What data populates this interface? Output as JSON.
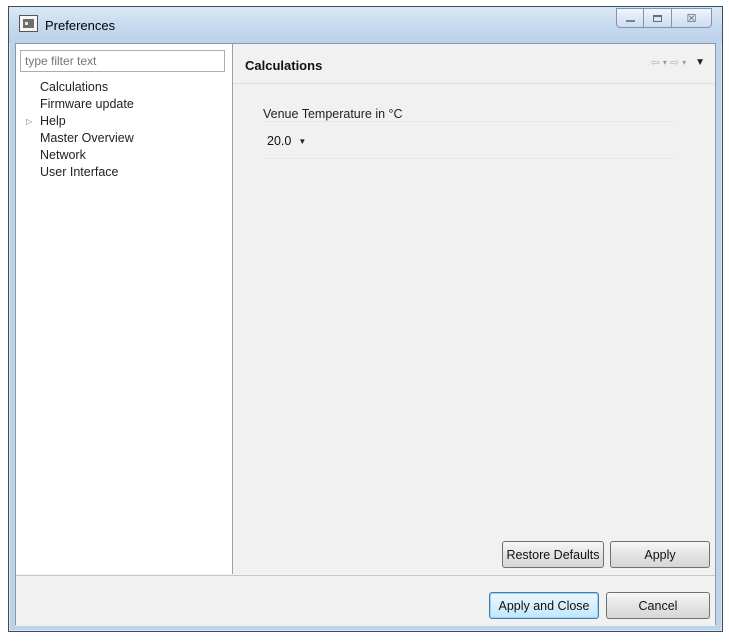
{
  "window": {
    "title": "Preferences",
    "app_icon": "preferences-app-icon",
    "controls": [
      "minimize-icon",
      "maximize-icon",
      "close-icon"
    ],
    "close_glyph": "☒"
  },
  "sidebar": {
    "filter_placeholder": "type filter text",
    "items": [
      {
        "label": "Calculations",
        "expandable": false
      },
      {
        "label": "Firmware update",
        "expandable": false
      },
      {
        "label": "Help",
        "expandable": true
      },
      {
        "label": "Master Overview",
        "expandable": false
      },
      {
        "label": "Network",
        "expandable": false
      },
      {
        "label": "User Interface",
        "expandable": false
      }
    ],
    "expander_glyph": "▷"
  },
  "page": {
    "title": "Calculations",
    "nav": {
      "back_glyph": "⇦",
      "forward_glyph": "⇨",
      "dropdown_glyph": "▾",
      "menu_glyph": "▼"
    },
    "venue_temperature": {
      "label": "Venue Temperature in °C",
      "value": "20.0",
      "caret": "▼"
    }
  },
  "buttons": {
    "restore_defaults": "Restore Defaults",
    "apply": "Apply",
    "apply_and_close": "Apply and Close",
    "cancel": "Cancel"
  },
  "colors": {
    "title_bar": "#c5d9ee",
    "dialog_background": "#f1f1f1",
    "default_button": "#bee6fd"
  }
}
